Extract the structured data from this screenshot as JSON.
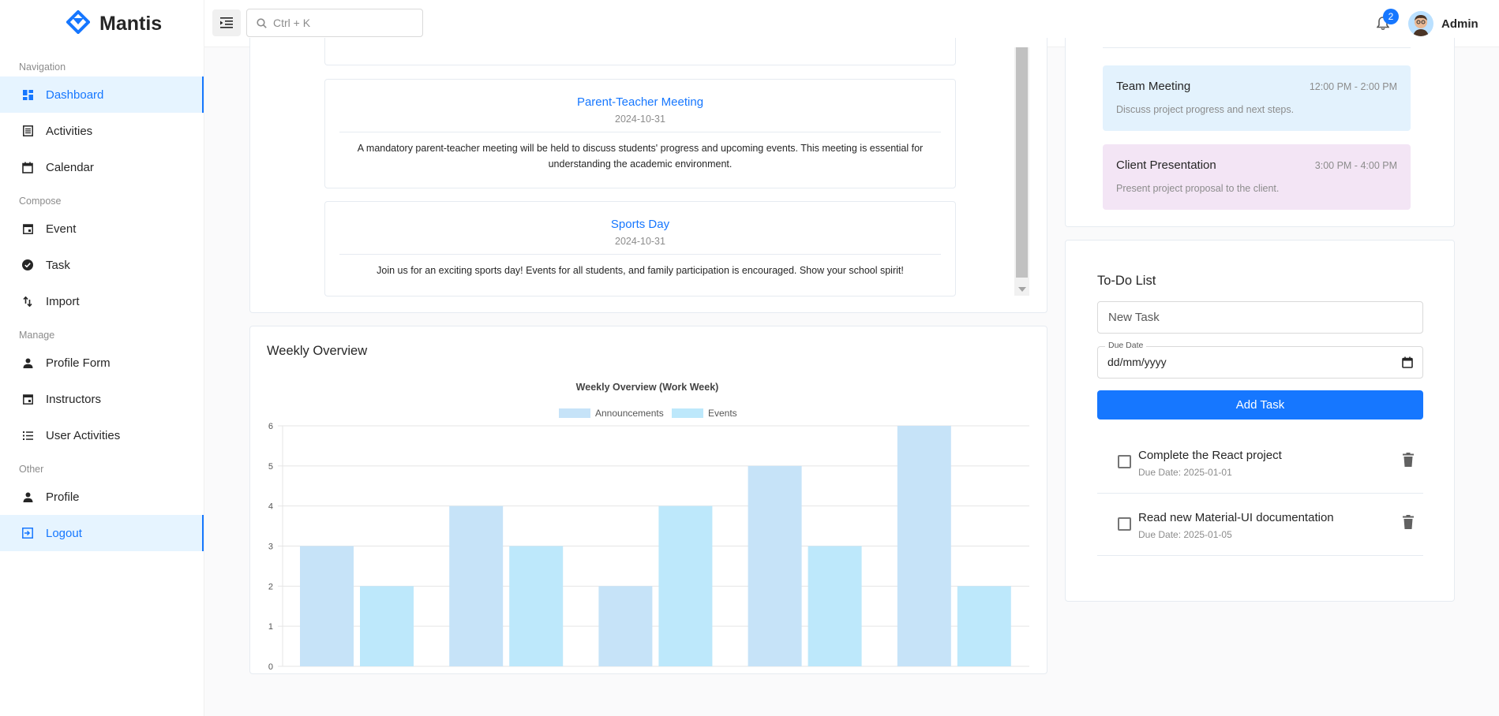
{
  "brand": {
    "name": "Mantis"
  },
  "header": {
    "search_placeholder": "Ctrl + K",
    "notification_count": "2",
    "user_name": "Admin"
  },
  "sidebar": {
    "groups": [
      {
        "label": "Navigation",
        "items": [
          {
            "label": "Dashboard",
            "icon": "dashboard-icon",
            "active": true
          },
          {
            "label": "Activities",
            "icon": "list-icon"
          },
          {
            "label": "Calendar",
            "icon": "calendar-icon"
          }
        ]
      },
      {
        "label": "Compose",
        "items": [
          {
            "label": "Event",
            "icon": "event-icon"
          },
          {
            "label": "Task",
            "icon": "check-circle-icon"
          },
          {
            "label": "Import",
            "icon": "import-icon"
          }
        ]
      },
      {
        "label": "Manage",
        "items": [
          {
            "label": "Profile Form",
            "icon": "person-icon"
          },
          {
            "label": "Instructors",
            "icon": "event-icon"
          },
          {
            "label": "User Activities",
            "icon": "list-bullets-icon"
          }
        ]
      },
      {
        "label": "Other",
        "items": [
          {
            "label": "Profile",
            "icon": "person-icon"
          },
          {
            "label": "Logout",
            "icon": "logout-icon",
            "active": true
          }
        ]
      }
    ]
  },
  "announcements": [
    {
      "title": "Parent-Teacher Meeting",
      "date": "2024-10-31",
      "description": "A mandatory parent-teacher meeting will be held to discuss students' progress and upcoming events. This meeting is essential for understanding the academic environment."
    },
    {
      "title": "Sports Day",
      "date": "2024-10-31",
      "description": "Join us for an exciting sports day! Events for all students, and family participation is encouraged. Show your school spirit!"
    }
  ],
  "weekly": {
    "card_title": "Weekly Overview"
  },
  "chart_data": {
    "type": "bar",
    "title": "Weekly Overview (Work Week)",
    "categories": [
      "",
      "",
      "",
      "",
      ""
    ],
    "series": [
      {
        "name": "Announcements",
        "values": [
          3,
          4,
          2,
          5,
          6
        ],
        "color": "#c6e3f8"
      },
      {
        "name": "Events",
        "values": [
          2,
          3,
          4,
          3,
          2
        ],
        "color": "#bde8fb"
      }
    ],
    "yticks": [
      "0",
      "1",
      "2",
      "3",
      "4",
      "5",
      "6"
    ],
    "ylim": [
      0,
      6
    ],
    "grid": true,
    "legend": "top"
  },
  "schedule": [
    {
      "title": "Team Meeting",
      "time": "12:00 PM - 2:00 PM",
      "description": "Discuss project progress and next steps.",
      "color": "#e3f2fd"
    },
    {
      "title": "Client Presentation",
      "time": "3:00 PM - 4:00 PM",
      "description": "Present project proposal to the client.",
      "color": "#f3e5f5"
    }
  ],
  "todo": {
    "title": "To-Do List",
    "new_task_placeholder": "New Task",
    "due_date_label": "Due Date",
    "due_date_value": "dd/mm/yyyy",
    "add_label": "Add Task",
    "items": [
      {
        "text": "Complete the React project",
        "due": "Due Date: 2025-01-01"
      },
      {
        "text": "Read new Material-UI documentation",
        "due": "Due Date: 2025-01-05"
      }
    ]
  }
}
